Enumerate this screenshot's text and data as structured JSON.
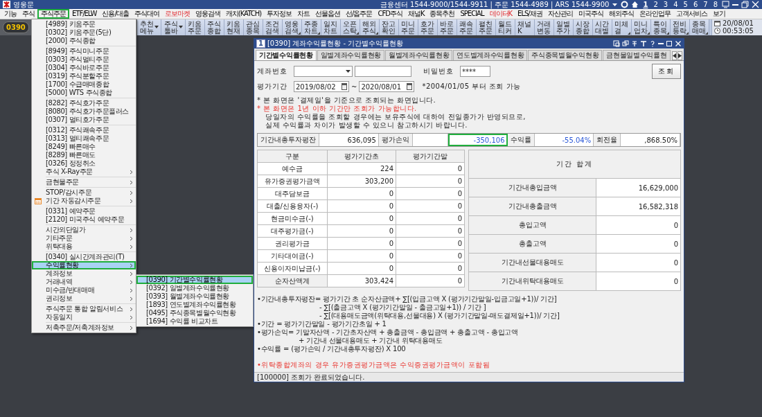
{
  "app": {
    "title": "영웅문",
    "info": "금융센터 1544-9000/1544-9911 | 주문 1544-4989 | ARS 1544-9900",
    "screens": [
      {
        "label": "1",
        "selected": true
      },
      {
        "label": "2",
        "selected": false
      },
      {
        "label": "3",
        "selected": false
      },
      {
        "label": "4",
        "selected": false
      },
      {
        "label": "5",
        "selected": false
      },
      {
        "label": "6",
        "selected": false
      },
      {
        "label": "7",
        "selected": false
      },
      {
        "label": "8",
        "selected": false
      }
    ]
  },
  "menu_bar": [
    {
      "label": "기능",
      "accent": false,
      "highlighted": false
    },
    {
      "label": "주식",
      "accent": false,
      "highlighted": false
    },
    {
      "label": "주식주문",
      "accent": false,
      "highlighted": true
    },
    {
      "label": "ETF/ELW",
      "accent": false,
      "highlighted": false
    },
    {
      "label": "신용/대출",
      "accent": false,
      "highlighted": false
    },
    {
      "label": "주식대여",
      "accent": false,
      "highlighted": false
    },
    {
      "label": "로보마켓",
      "accent": true,
      "highlighted": false
    },
    {
      "label": "영웅검색",
      "accent": false,
      "highlighted": false
    },
    {
      "label": "캐치(KATCH)",
      "accent": false,
      "highlighted": false
    },
    {
      "label": "투자정보",
      "accent": false,
      "highlighted": false
    },
    {
      "label": "차트",
      "accent": false,
      "highlighted": false
    },
    {
      "label": "선물옵션",
      "accent": false,
      "highlighted": false
    },
    {
      "label": "선/옵주문",
      "accent": false,
      "highlighted": false
    },
    {
      "label": "CFD주식",
      "accent": false,
      "highlighted": false
    },
    {
      "label": "채널K",
      "accent": false,
      "highlighted": false
    },
    {
      "label": "종목추천",
      "accent": false,
      "highlighted": false
    },
    {
      "label": "SPECIAL",
      "accent": false,
      "highlighted": false
    },
    {
      "label": "데이터K",
      "accent": true,
      "highlighted": false
    },
    {
      "label": "ELS/채권",
      "accent": false,
      "highlighted": false
    },
    {
      "label": "자산관리",
      "accent": false,
      "highlighted": false
    },
    {
      "label": "미국주식",
      "accent": false,
      "highlighted": false
    },
    {
      "label": "해외주식",
      "accent": false,
      "highlighted": false
    },
    {
      "label": "온라인업무",
      "accent": false,
      "highlighted": false
    },
    {
      "label": "고객서비스",
      "accent": false,
      "highlighted": false
    },
    {
      "label": "보기",
      "accent": false,
      "highlighted": false
    }
  ],
  "toolbar": {
    "screen_number": "0390",
    "date": "20/08/01",
    "time": "00:53:05",
    "buttons": [
      {
        "lines": [
          "추천",
          "메뉴"
        ],
        "kind": "dropdown"
      },
      {
        "lines": [
          "주식",
          "툴바"
        ],
        "kind": "dropdown"
      },
      {
        "lines": [
          "키움",
          "주문"
        ],
        "kind": "plain"
      },
      {
        "lines": [
          "주식",
          "종합"
        ],
        "kind": "plain"
      },
      {
        "lines": [
          "키움",
          "현재"
        ],
        "kind": "plain"
      },
      {
        "lines": [
          "관심",
          "종목"
        ],
        "kind": "plain"
      },
      {
        "lines": [
          "조건",
          "검색"
        ],
        "kind": "plain"
      },
      {
        "lines": [
          "영웅",
          "검색"
        ],
        "kind": "corner"
      },
      {
        "lines": [
          "주종",
          "차트"
        ],
        "kind": "corner"
      },
      {
        "lines": [
          "일지",
          "차트"
        ],
        "kind": "plain"
      },
      {
        "lines": [
          "오픈",
          "스탁"
        ],
        "kind": "corner"
      },
      {
        "lines": [
          "해외",
          "주식"
        ],
        "kind": "corner"
      },
      {
        "lines": [
          "잔고",
          "확인"
        ],
        "kind": "plain"
      },
      {
        "lines": [
          "미니",
          "주문"
        ],
        "kind": "plain"
      },
      {
        "lines": [
          "호가",
          "주문"
        ],
        "kind": "plain"
      },
      {
        "lines": [
          "바로",
          "주문"
        ],
        "kind": "plain"
      },
      {
        "lines": [
          "쾌속",
          "주문"
        ],
        "kind": "plain"
      },
      {
        "lines": [
          "펼친",
          "주문"
        ],
        "kind": "plain"
      },
      {
        "lines": [
          "월드",
          "티커"
        ],
        "kind": "plain"
      },
      {
        "lines": [
          "채널",
          "K"
        ],
        "kind": "plain"
      },
      {
        "lines": [
          "거래",
          "변동"
        ],
        "kind": "plain"
      },
      {
        "lines": [
          "일별",
          "주가"
        ],
        "kind": "plain"
      },
      {
        "lines": [
          "시장",
          "종합"
        ],
        "kind": "plain"
      },
      {
        "lines": [
          "시간",
          "대별"
        ],
        "kind": "plain"
      },
      {
        "lines": [
          "미체",
          "결"
        ],
        "kind": "corner"
      },
      {
        "lines": [
          "미니",
          "업차"
        ],
        "kind": "corner"
      },
      {
        "lines": [
          "특이",
          "종목"
        ],
        "kind": "corner"
      },
      {
        "lines": [
          "전비",
          "등락"
        ],
        "kind": "corner"
      },
      {
        "lines": [
          "종목",
          "매매"
        ],
        "kind": "corner"
      }
    ]
  },
  "order_menu": {
    "groups": [
      [
        {
          "label": "[4989] 키움주문",
          "submenu": false,
          "selected": false,
          "highlighted": false
        },
        {
          "label": "[0302] 키움주문(5단)",
          "submenu": false,
          "selected": false,
          "highlighted": false
        },
        {
          "label": "[2000] 주식종합",
          "submenu": false,
          "selected": false,
          "highlighted": false
        }
      ],
      [
        {
          "label": "[8949] 주식미니주문",
          "submenu": false,
          "selected": false,
          "highlighted": false
        },
        {
          "label": "[0303] 주식멀티주문",
          "submenu": false,
          "selected": false,
          "highlighted": false
        },
        {
          "label": "[0304] 주식바로주문",
          "submenu": false,
          "selected": false,
          "highlighted": false
        },
        {
          "label": "[0319] 주식분할주문",
          "submenu": false,
          "selected": false,
          "highlighted": false
        },
        {
          "label": "[1700] 수급매매종합",
          "submenu": false,
          "selected": false,
          "highlighted": false
        },
        {
          "label": "[5000] WTS 주식종합",
          "submenu": false,
          "selected": false,
          "highlighted": false
        }
      ],
      [
        {
          "label": "[8282] 주식호가주문",
          "submenu": false,
          "selected": false,
          "highlighted": false
        },
        {
          "label": "[8080] 주식호가주문플러스",
          "submenu": false,
          "selected": false,
          "highlighted": false
        },
        {
          "label": "[0307] 멀티호가주문",
          "submenu": false,
          "selected": false,
          "highlighted": false
        }
      ],
      [
        {
          "label": "[0312] 주식쾌속주문",
          "submenu": false,
          "selected": false,
          "highlighted": false
        },
        {
          "label": "[0313] 멀티쾌속주문",
          "submenu": false,
          "selected": false,
          "highlighted": false
        },
        {
          "label": "[8249] 빠른매수",
          "submenu": false,
          "selected": false,
          "highlighted": false
        },
        {
          "label": "[8289] 빠른매도",
          "submenu": false,
          "selected": false,
          "highlighted": false
        },
        {
          "label": "[0326] 정정취소",
          "submenu": false,
          "selected": false,
          "highlighted": false
        },
        {
          "label": "주식 X-Ray주문",
          "submenu": true,
          "selected": false,
          "highlighted": false
        }
      ],
      [
        {
          "label": "금현물주문",
          "submenu": true,
          "selected": false,
          "highlighted": false
        }
      ],
      [
        {
          "label": "STOP/감시주문",
          "submenu": true,
          "selected": false,
          "highlighted": false
        },
        {
          "label": "기간 자동감시주문",
          "submenu": true,
          "selected": false,
          "highlighted": false,
          "icon": true
        }
      ],
      [
        {
          "label": "[0331] 예약주문",
          "submenu": false,
          "selected": false,
          "highlighted": false
        },
        {
          "label": "[2120] 미국주식 예약주문",
          "submenu": false,
          "selected": false,
          "highlighted": false
        }
      ],
      [
        {
          "label": "시간외단일가",
          "submenu": true,
          "selected": false,
          "highlighted": false
        },
        {
          "label": "기타주문",
          "submenu": true,
          "selected": false,
          "highlighted": false
        },
        {
          "label": "위탁대용",
          "submenu": true,
          "selected": false,
          "highlighted": false
        }
      ],
      [
        {
          "label": "[0340] 실시간계좌관리(T)",
          "submenu": false,
          "selected": false,
          "highlighted": false
        },
        {
          "label": "수익률현황",
          "submenu": true,
          "selected": true,
          "highlighted": true
        },
        {
          "label": "계좌정보",
          "submenu": true,
          "selected": false,
          "highlighted": false
        },
        {
          "label": "거래내역",
          "submenu": true,
          "selected": false,
          "highlighted": false
        },
        {
          "label": "미수금/반대매매",
          "submenu": true,
          "selected": false,
          "highlighted": false
        },
        {
          "label": "권리정보",
          "submenu": true,
          "selected": false,
          "highlighted": false
        }
      ],
      [
        {
          "label": "주식주문 통합 알림서비스",
          "submenu": true,
          "selected": false,
          "highlighted": false
        },
        {
          "label": "자동일지",
          "submenu": true,
          "selected": false,
          "highlighted": false
        }
      ],
      [
        {
          "label": "저축주문/저축계좌정보",
          "submenu": true,
          "selected": false,
          "highlighted": false
        }
      ]
    ],
    "submenu": [
      {
        "label": "[0390] 기간별수익률현황",
        "selected": true,
        "highlighted": true
      },
      {
        "label": "[0392] 일별계좌수익률현황",
        "selected": false,
        "highlighted": false
      },
      {
        "label": "[0393] 월별계좌수익률현황",
        "selected": false,
        "highlighted": false
      },
      {
        "label": "[1893] 연도별계좌수익률현황",
        "selected": false,
        "highlighted": false
      },
      {
        "label": "[0495] 주식종목별월수익현황",
        "selected": false,
        "highlighted": false
      },
      {
        "label": "[1694] 수익률 비교차트",
        "selected": false,
        "highlighted": false
      }
    ]
  },
  "dialog": {
    "window_number": "1",
    "title": "[0390] 계좌수익률현황 - 기간별수익률현황",
    "tabs": [
      {
        "label": "기간별수익률현황",
        "selected": true
      },
      {
        "label": "일별계좌수익률현황",
        "selected": false
      },
      {
        "label": "월별계좌수익률현황",
        "selected": false
      },
      {
        "label": "연도별계좌수익률현황",
        "selected": false
      },
      {
        "label": "주식종목별월수익현황",
        "selected": false
      },
      {
        "label": "금현물일별수익률현",
        "selected": false
      }
    ],
    "account_label": "계좌번호",
    "password_label": "비밀번호",
    "password_value": "****",
    "query_button": "조회",
    "period_label": "평가기간",
    "date_from": "2019/08/02",
    "date_sep": "~",
    "date_to": "2020/08/01",
    "period_hint": "*2004/01/05 부터 조회 가능",
    "notes": [
      {
        "text": "* 본 화면은 '결제일'을 기준으로 조회되는 화면입니다.",
        "kind": "info"
      },
      {
        "text": "* 본 화면은 1년 이하 기간만 조회가 가능합니다.",
        "kind": "warning"
      },
      {
        "text": "당일자의 수익률을 조회할 경우에는 보유주식에 대하여 전일종가가 반영되므로,",
        "kind": "detail"
      },
      {
        "text": "실제 수익률과 차이가 발생할 수 있으니 참고하시기 바랍니다.",
        "kind": "detail"
      }
    ],
    "summary": [
      {
        "kind": "label",
        "text": "기간내총투자평잔"
      },
      {
        "kind": "value",
        "text": "636,095",
        "negative": false,
        "highlighted": false
      },
      {
        "kind": "label",
        "text": "평가손익"
      },
      {
        "kind": "blank"
      },
      {
        "kind": "value",
        "text": "-350,106",
        "negative": true,
        "highlighted": true
      },
      {
        "kind": "label",
        "text": "수익률"
      },
      {
        "kind": "value",
        "text": "-55.04%",
        "negative": true,
        "highlighted": false
      },
      {
        "kind": "label",
        "text": "회전율"
      },
      {
        "kind": "value",
        "text": ",868.50%",
        "negative": false,
        "highlighted": false
      }
    ],
    "left_table": {
      "columns": [
        "구분",
        "평가기간초",
        "평가기간말"
      ],
      "rows": [
        [
          "예수금",
          "224",
          "0"
        ],
        [
          "유가증권평가금액",
          "303,200",
          "0"
        ],
        [
          "대주담보금",
          "0",
          "0"
        ],
        [
          "대출/신용융자(-)",
          "0",
          "0"
        ],
        [
          "현금미수금(-)",
          "0",
          "0"
        ],
        [
          "대주평가금(-)",
          "0",
          "0"
        ],
        [
          "권리평가금",
          "0",
          "0"
        ],
        [
          "기타대여금(-)",
          "0",
          "0"
        ],
        [
          "신용이자미납금(-)",
          "0",
          "0"
        ],
        [
          "순자산액계",
          "303,424",
          "0"
        ]
      ]
    },
    "right_table": {
      "title": "기간 합계",
      "rows": [
        [
          "기간내총입금액",
          "16,629,000"
        ],
        [
          "기간내총출금액",
          "16,582,318"
        ],
        [
          "총입고액",
          "0"
        ],
        [
          "총출고액",
          "0"
        ],
        [
          "기간내선물대용매도",
          "0"
        ],
        [
          "기간내위탁대용매도",
          "0"
        ]
      ]
    },
    "formulas": [
      {
        "text": "•기간내총투자평잔= 평가기간 초 순자산금액+ ∑[(입금고액 X (평가기간말일-입금고일+1))/ 기간]",
        "kind": "head"
      },
      {
        "text": "-  ∑[(출금고액 X (평가기간말일 - 출금고일+1)) / 기간 ]",
        "kind": "continued"
      },
      {
        "text": "-  ∑[(대용매도금액(위탁대용,선물대용) X (평가기간말일-매도결제일+1))/ 기간]",
        "kind": "continued"
      },
      {
        "text": "•기간     = 평가기간말일 - 평가기간초일 + 1",
        "kind": "head"
      },
      {
        "text": "•평가손익= 기말자산액 -  기간초자산액 + 총출금액 - 총입금액 + 총출고액 - 총입고액",
        "kind": "head"
      },
      {
        "text": "+ 기간내 선물대용매도  + 기간내 위탁대용매도",
        "kind": "wrapped"
      },
      {
        "text": "•수익률  = (평가손익 / 기간내총투자평잔) X 100",
        "kind": "head"
      }
    ],
    "footnote": "•위탁종합계좌의 경우 유가증권평가금액은 수익증권평가금액이 포함됨",
    "status": "[100000] 조회가 완료되었습니다."
  }
}
